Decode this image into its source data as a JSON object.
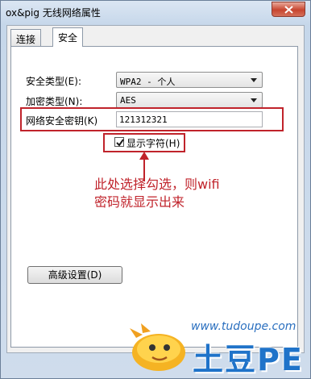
{
  "window": {
    "title": "ox&pig 无线网络属性"
  },
  "tabs": [
    {
      "label": "连接"
    },
    {
      "label": "安全"
    }
  ],
  "security": {
    "type_label": "安全类型(E):",
    "type_value": "WPA2 - 个人",
    "encryption_label": "加密类型(N):",
    "encryption_value": "AES",
    "key_label": "网络安全密钥(K)",
    "key_value": "121312321",
    "show_chars_label": "显示字符(H)",
    "show_chars_checked": true
  },
  "annotation": {
    "line1": "此处选择勾选，则wifi",
    "line2": "密码就显示出来",
    "color": "#c0232b"
  },
  "advanced_button": {
    "label": "高级设置(D)"
  },
  "watermark": {
    "url": "www.tudoupe.com",
    "name": "土豆PE"
  }
}
